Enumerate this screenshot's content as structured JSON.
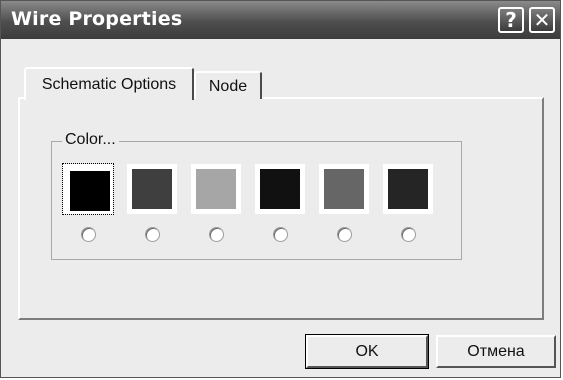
{
  "window": {
    "title": "Wire Properties",
    "help_button": "?",
    "close_button": "✕"
  },
  "tabs": [
    {
      "label": "Schematic Options",
      "active": true
    },
    {
      "label": "Node",
      "active": false
    }
  ],
  "color_group": {
    "label": "Color...",
    "swatches": [
      {
        "color": "#000000",
        "selected": true
      },
      {
        "color": "#3f3f3f",
        "selected": false
      },
      {
        "color": "#a6a6a6",
        "selected": false
      },
      {
        "color": "#111111",
        "selected": false
      },
      {
        "color": "#666666",
        "selected": false
      },
      {
        "color": "#252525",
        "selected": false
      }
    ]
  },
  "buttons": {
    "ok": "OK",
    "cancel": "Отмена"
  }
}
